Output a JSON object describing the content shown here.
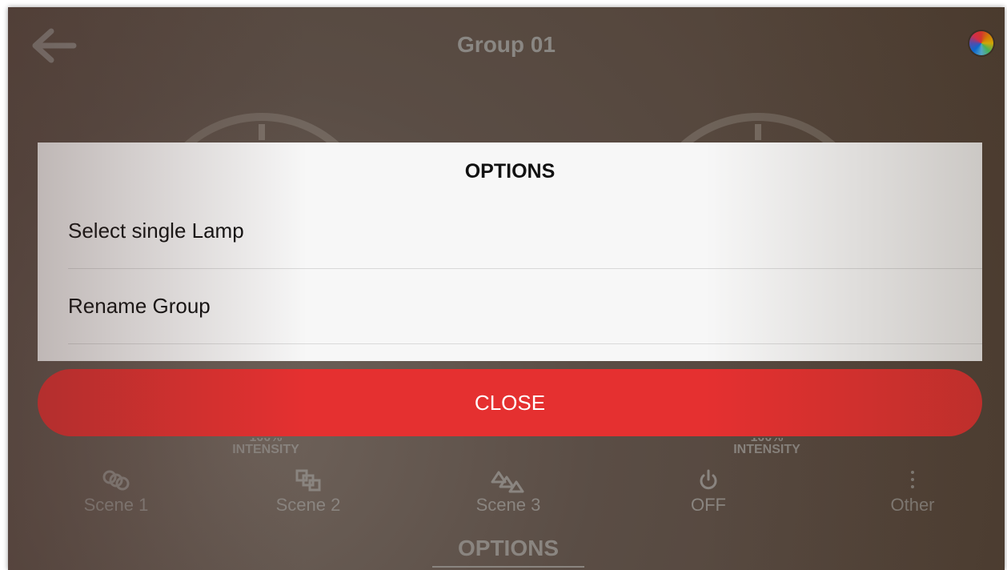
{
  "header": {
    "title": "Group 01",
    "back_icon": "arrow-left-icon",
    "color_icon": "color-wheel-icon"
  },
  "intensity": {
    "left_percent": "100%",
    "left_label": "INTENSITY",
    "right_percent": "100%",
    "right_label": "INTENSITY"
  },
  "scenes": [
    {
      "label": "Scene 1",
      "icon": "rings-icon"
    },
    {
      "label": "Scene 2",
      "icon": "squares-icon"
    },
    {
      "label": "Scene 3",
      "icon": "triangles-icon"
    },
    {
      "label": "OFF",
      "icon": "power-icon"
    },
    {
      "label": "Other",
      "icon": "more-vertical-icon"
    }
  ],
  "bottom_tab": {
    "label": "OPTIONS"
  },
  "dialog": {
    "title": "OPTIONS",
    "options": [
      {
        "label": "Select single Lamp"
      },
      {
        "label": "Rename Group"
      }
    ],
    "close_label": "CLOSE"
  },
  "colors": {
    "close_button": "#e53030",
    "dialog_bg": "#f7f7f7"
  }
}
